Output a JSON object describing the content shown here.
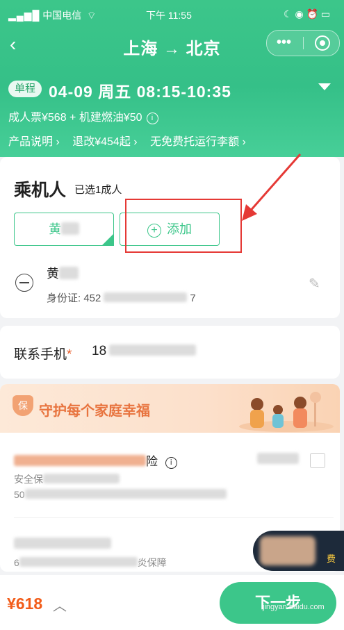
{
  "status_bar": {
    "carrier": "中国电信",
    "time": "下午 11:55"
  },
  "header": {
    "title": "上海 → 北京",
    "trip_tag": "单程",
    "flight_info": "04-09  周五  08:15-10:35",
    "price_line": "成人票¥568 + 机建燃油¥50",
    "links": [
      "产品说明 ›",
      "退改¥454起 ›",
      "无免费托运行李额 ›"
    ]
  },
  "passengers": {
    "title": "乘机人",
    "subtitle": "已选1成人",
    "selected_chip": "黄",
    "add_label": "添加",
    "passenger_name": "黄",
    "id_label": "身份证: 452",
    "id_suffix": "7"
  },
  "contact": {
    "label": "联系手机",
    "required_mark": "*",
    "value": "18"
  },
  "insurance": {
    "banner_title": "守护每个家庭幸福",
    "banner_icon": "保",
    "row1_title_suffix": "险",
    "row1_sub": "安全保",
    "row1_sub2": "50",
    "row2_sub": "6",
    "row2_sub_suffix": "炎保障"
  },
  "promo": {
    "text": "费"
  },
  "bottom": {
    "total": "¥618",
    "next_label": "下一步",
    "watermark": "jingyan.baidu.com"
  },
  "colors": {
    "brand_green": "#3cc68a",
    "price_orange": "#f25c19",
    "annotation_red": "#e53935"
  }
}
